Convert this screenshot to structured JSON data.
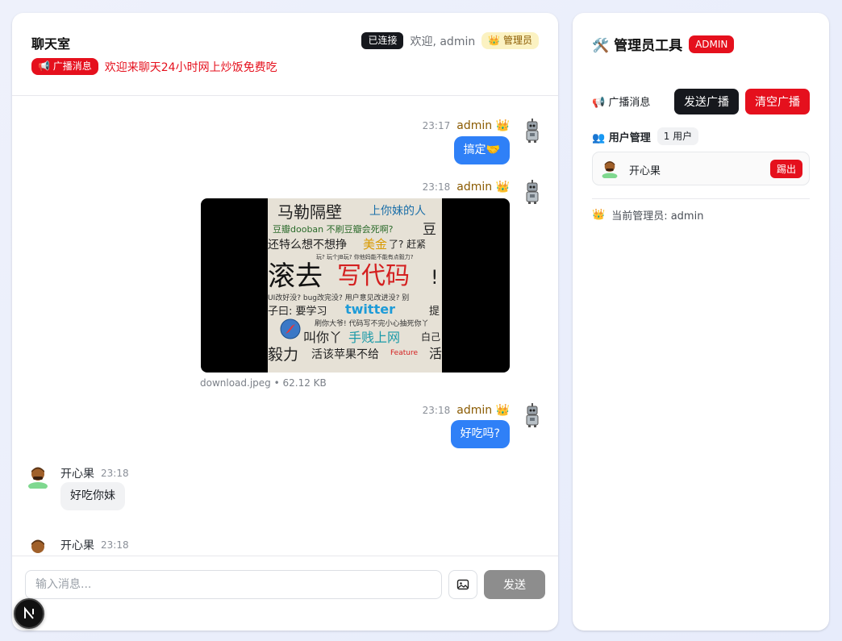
{
  "chat": {
    "title": "聊天室",
    "connection_status": "已连接",
    "welcome": "欢迎, admin",
    "role": "👑 管理员",
    "broadcast_badge": "📢 广播消息",
    "broadcast_text": "欢迎来聊天24小时网上炒饭免费吃"
  },
  "messages": [
    {
      "time": "23:17",
      "sender": "admin 👑",
      "text": "搞定🤝"
    },
    {
      "time": "23:18",
      "sender": "admin 👑",
      "file_caption": "download.jpeg • 62.12 KB"
    },
    {
      "time": "23:18",
      "sender": "admin 👑",
      "text": "好吃吗?"
    },
    {
      "time": "23:18",
      "sender": "开心果",
      "text": "好吃你妹"
    },
    {
      "time": "23:18",
      "sender": "开心果"
    }
  ],
  "image_text": {
    "line1": "马勒隔壁",
    "line1b": "上你妹的人",
    "line2": "豆瓣dooban 不刷豆瓣会死啊?",
    "line2b": "豆",
    "line3": "还特么想不想挣",
    "line3b": "美金",
    "line3c": "了? 赶紧",
    "line4": "玩? 玩个JB玩? 你他妈能不能有点毅力?",
    "line5": "滚去",
    "line5b": "写代码",
    "line5c": "!",
    "line6": "UI改好没? bug改完没? 用户意见改进没? 别",
    "line7": "子曰: 要学习",
    "line7b": "twitter",
    "line7c": "提",
    "line8": "刷你大爷! 代码写不完小心抽死你丫",
    "line9": "叫你丫",
    "line9b": "手贱上网",
    "line9c": "白己",
    "line10": "毅力",
    "line10b": "活该苹果不给",
    "line10c": "Feature",
    "line10d": "活"
  },
  "composer": {
    "placeholder": "输入消息...",
    "image_icon": "image-icon",
    "send_label": "发送"
  },
  "admin": {
    "title": "🛠️ 管理员工具",
    "tag": "ADMIN",
    "broadcast_label": "📢 广播消息",
    "send_broadcast": "发送广播",
    "clear_broadcast": "清空广播",
    "user_mgmt_label": "👥 用户管理",
    "user_count": "1 用户",
    "users": [
      {
        "name": "开心果",
        "kick_label": "踢出"
      }
    ],
    "current_admin": "当前管理员: admin",
    "crown": "👑"
  },
  "dev_badge_letter": "N",
  "colors": {
    "primary_blue": "#2f80f7",
    "danger_red": "#e5101d",
    "dark": "#16181d",
    "admin_name": "#8a5a00"
  }
}
